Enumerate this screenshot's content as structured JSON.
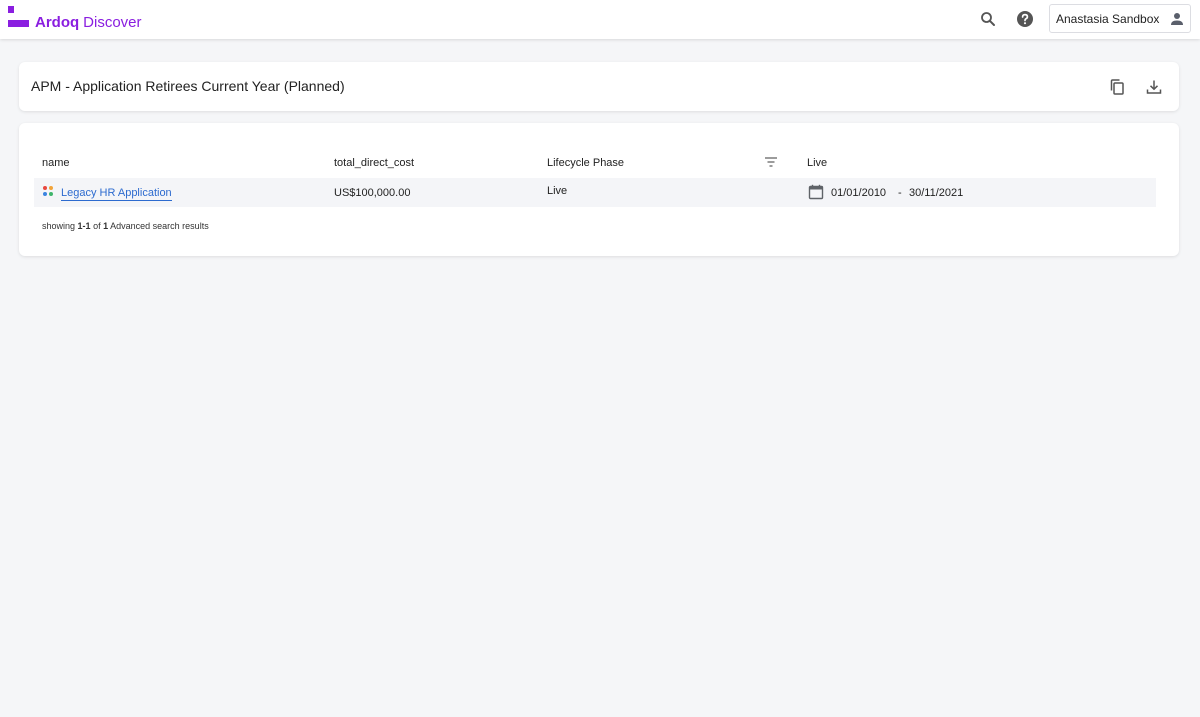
{
  "app": {
    "brand_name": "Ardoq",
    "brand_product": "Discover",
    "brand_color": "#8a1ee0"
  },
  "topbar": {
    "search_icon": "search-icon",
    "help_icon": "help-icon",
    "user_name": "Anastasia Sandbox",
    "user_icon": "person-icon"
  },
  "report": {
    "title": "APM - Application Retirees Current Year (Planned)",
    "actions": [
      "copy-icon",
      "download-icon"
    ]
  },
  "table": {
    "columns": [
      "name",
      "total_direct_cost",
      "Lifecycle Phase",
      "Live"
    ],
    "rows": [
      {
        "name": "Legacy HR Application",
        "total_direct_cost": "US$100,000.00",
        "lifecycle_phase": "Live",
        "live_start": "01/01/2010",
        "live_separator": "-",
        "live_end": "30/11/2021"
      }
    ],
    "footer": {
      "prefix": "showing",
      "range": "1-1",
      "of": "of",
      "total": "1",
      "suffix": "Advanced search results"
    }
  }
}
